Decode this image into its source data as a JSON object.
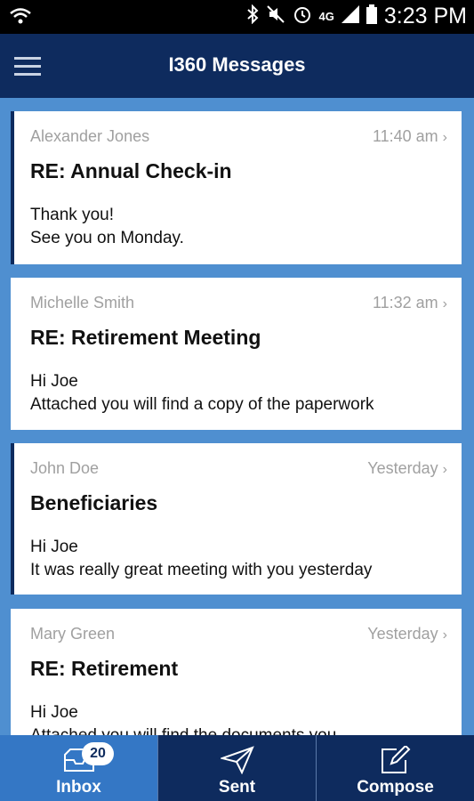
{
  "status_bar": {
    "time": "3:23 PM",
    "network": "4G"
  },
  "app_bar": {
    "title": "I360 Messages"
  },
  "messages": [
    {
      "from": "Alexander Jones",
      "time": "11:40 am",
      "subject": "RE: Annual Check-in",
      "line1": "Thank you!",
      "line2": "See you on Monday.",
      "unread": true
    },
    {
      "from": "Michelle Smith",
      "time": "11:32 am",
      "subject": "RE: Retirement Meeting",
      "line1": "Hi Joe",
      "line2": "Attached you will find a copy of the paperwork",
      "unread": false
    },
    {
      "from": "John Doe",
      "time": "Yesterday",
      "subject": "Beneficiaries",
      "line1": "Hi Joe",
      "line2": "It was really great meeting with you yesterday",
      "unread": true
    },
    {
      "from": "Mary Green",
      "time": "Yesterday",
      "subject": "RE: Retirement",
      "line1": "Hi Joe",
      "line2": "Attached you will find the documents you",
      "unread": false
    }
  ],
  "tabs": [
    {
      "label": "Inbox",
      "badge": "20",
      "icon": "inbox-icon"
    },
    {
      "label": "Sent",
      "icon": "paper-plane-icon"
    },
    {
      "label": "Compose",
      "icon": "compose-icon"
    }
  ],
  "colors": {
    "header": "#0e2b5e",
    "background": "#4f8fd0",
    "active_tab": "#3477c5"
  }
}
